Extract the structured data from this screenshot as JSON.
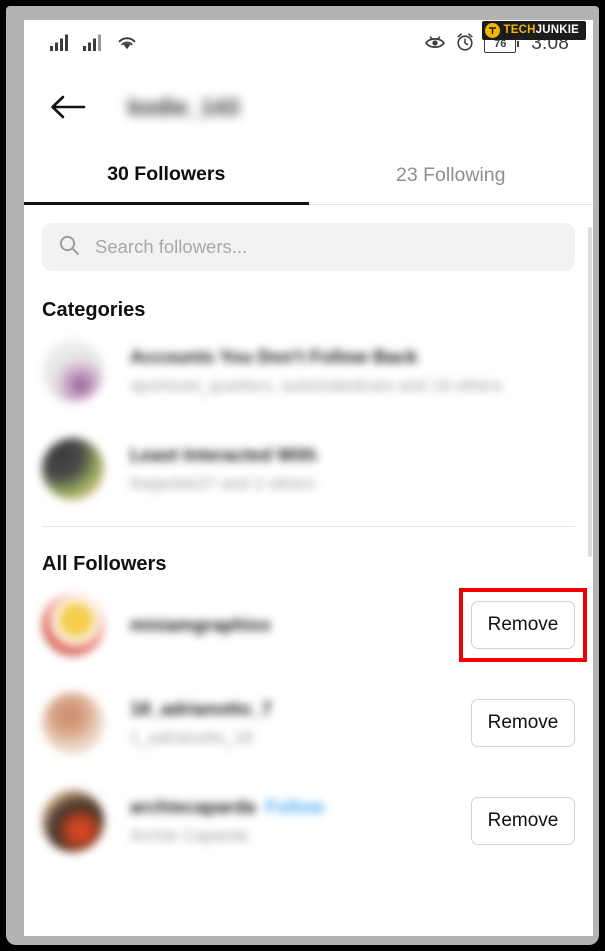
{
  "watermark": {
    "brand_first": "TECH",
    "brand_second": "JUNKIE",
    "logo_icon": "techjunkie-logo-icon"
  },
  "status_bar": {
    "signal_1_icon": "signal-bars-icon",
    "signal_2_icon": "signal-bars-icon",
    "wifi_icon": "wifi-icon",
    "eye_icon": "eye-icon",
    "alarm_icon": "alarm-clock-icon",
    "battery_level": "76",
    "time": "3:08"
  },
  "header": {
    "back_icon": "back-arrow-icon",
    "title": "kodie_143"
  },
  "tabs": [
    {
      "label": "30 Followers",
      "active": true
    },
    {
      "label": "23 Following",
      "active": false
    }
  ],
  "search": {
    "icon": "search-icon",
    "placeholder": "Search followers...",
    "value": ""
  },
  "categories_section": {
    "title": "Categories",
    "items": [
      {
        "avatar_icon": "category-avatar-stack",
        "primary": "Accounts You Don't Follow Back",
        "secondary": "sportsnet_quarters, automatedcars and 19 others"
      },
      {
        "avatar_icon": "category-avatar-stack",
        "primary": "Least Interacted With",
        "secondary": "thejackie27 and 2 others"
      }
    ]
  },
  "followers_section": {
    "title": "All Followers",
    "items": [
      {
        "avatar_icon": "user-avatar",
        "username": "mixiamgraphixx",
        "display_name": "",
        "follow_label": "",
        "action_label": "Remove",
        "highlighted": true
      },
      {
        "avatar_icon": "user-avatar",
        "username": "18_adrianotto_7",
        "display_name": "1_adrianotto_18",
        "follow_label": "",
        "action_label": "Remove",
        "highlighted": false
      },
      {
        "avatar_icon": "user-avatar",
        "username": "archiecaparda",
        "display_name": "Archie Caparda",
        "follow_label": "Follow",
        "action_label": "Remove",
        "highlighted": false
      }
    ]
  },
  "colors": {
    "accent_highlight": "#f00000",
    "follow_link": "#4aa8f0",
    "brand_gold": "#f2b705",
    "active_tab": "#111111",
    "inactive_tab": "#8e8e8e"
  }
}
